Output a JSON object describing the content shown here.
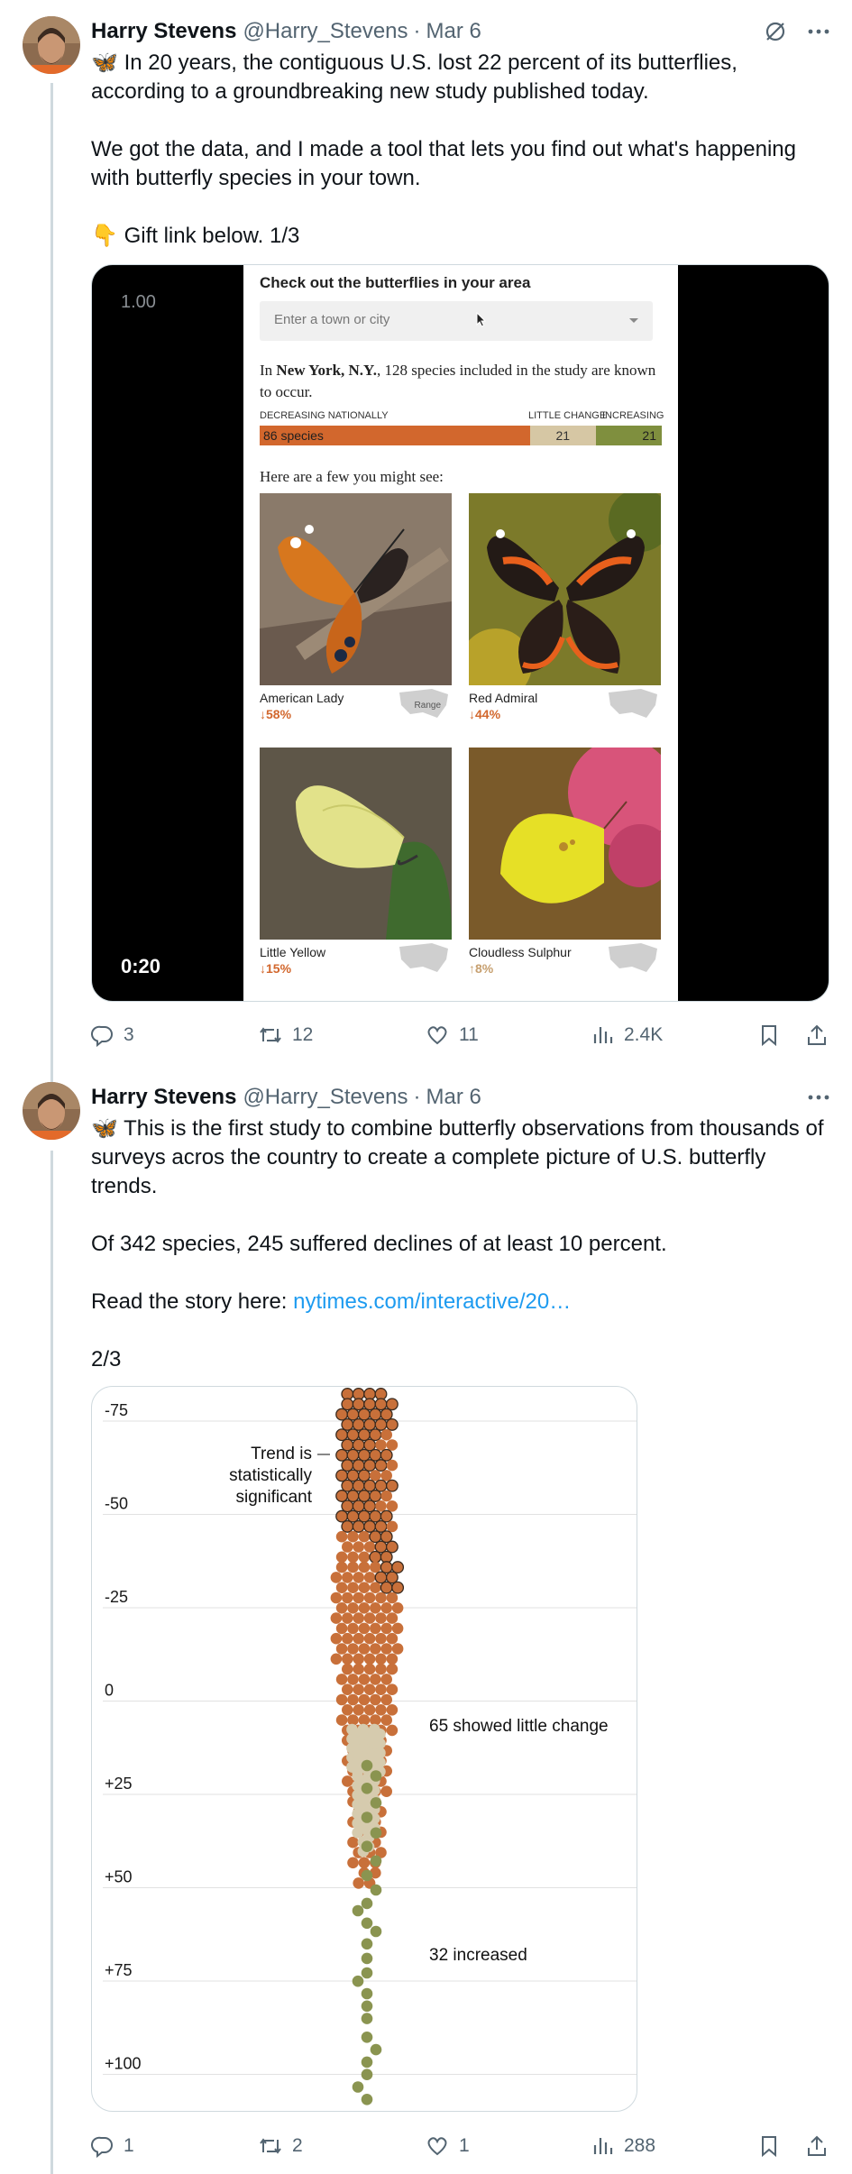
{
  "tweets": [
    {
      "author": {
        "name": "Harry Stevens",
        "handle": "@Harry_Stevens"
      },
      "date": "Mar 6",
      "emoji": "🦋",
      "text_line1": "In 20 years, the contiguous U.S. lost 22 percent of its butterflies, according to a groundbreaking new study published today.",
      "text_line2": "We got the data, and I made a tool that lets you find out what's happening with butterfly species in your town.",
      "pointer_emoji": "👇",
      "text_line3": "Gift link below. 1/3",
      "video": {
        "playback_rate": "1.00",
        "time": "0:20",
        "heading": "Check out the butterflies in your area",
        "search_placeholder": "Enter a town or city",
        "summary_prefix": "In",
        "summary_location": "New York, N.Y.",
        "summary_suffix": ", 128 species included in the study are known to occur.",
        "label_decreasing": "DECREASING NATIONALLY",
        "label_little": "LITTLE CHANGE",
        "label_increasing": "INCREASING",
        "bar": {
          "decreasing": 86,
          "little": 21,
          "increasing": 21,
          "decreasing_label": "86 species",
          "little_label": "21",
          "increasing_label": "21"
        },
        "subheading": "Here are a few you might see:",
        "butterflies": [
          {
            "name": "American Lady",
            "change": "↓58%",
            "map_label": "Range"
          },
          {
            "name": "Red Admiral",
            "change": "↓44%"
          },
          {
            "name": "Little Yellow",
            "change": "↓15%"
          },
          {
            "name": "Cloudless Sulphur",
            "change": "↑8%"
          }
        ]
      },
      "stats": {
        "replies": "3",
        "reposts": "12",
        "likes": "11",
        "views": "2.4K"
      }
    },
    {
      "author": {
        "name": "Harry Stevens",
        "handle": "@Harry_Stevens"
      },
      "date": "Mar 6",
      "emoji": "🦋",
      "text_line1": "This is the first study to combine butterfly observations from thousands of surveys acros the country to create a complete picture of U.S. butterfly trends.",
      "text_line2": "Of 342 species, 245 suffered declines of at least 10 percent.",
      "link_prefix": "Read the story here:",
      "link_text": "nytimes.com/interactive/20…",
      "text_line4": "2/3",
      "stats": {
        "replies": "1",
        "reposts": "2",
        "likes": "1",
        "views": "288"
      }
    }
  ],
  "chart_data": {
    "type": "scatter",
    "yticks": [
      "-75",
      "-50",
      "-25",
      "0",
      "+25",
      "+50",
      "+75",
      "+100"
    ],
    "ylim": [
      -80,
      110
    ],
    "annotations": {
      "significant": [
        "Trend is",
        "statistically",
        "significant"
      ],
      "little_change": "65 showed little change",
      "increased": "32 increased"
    },
    "groups": [
      {
        "category": "decreasing",
        "color": "#c8703a"
      },
      {
        "category": "little change",
        "count": 65,
        "color": "#d6cbae"
      },
      {
        "category": "increased",
        "count": 32,
        "color": "#8a9450"
      }
    ]
  },
  "colors": {
    "link": "#1d9bf0",
    "secondary_text": "#536471",
    "decreasing": "#d2672d",
    "little": "#d6c7a4",
    "increasing": "#7f8f3e"
  }
}
